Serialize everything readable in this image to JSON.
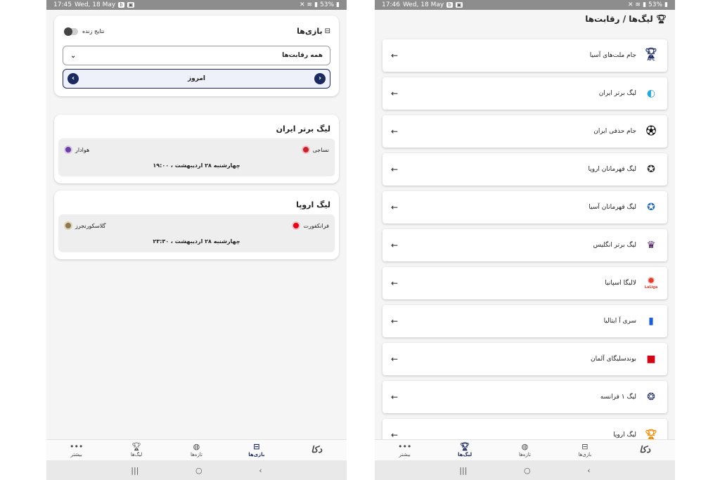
{
  "left": {
    "status": {
      "time": "17:45",
      "date": "Wed, 18 May",
      "battery": "53%"
    },
    "games_card": {
      "title": "بازی‌ها",
      "live_results_label": "نتایج زنده",
      "competition_select": "همه رقابت‌ها",
      "date_label": "امروز"
    },
    "leagues": [
      {
        "name": "لیگ برتر ایران",
        "home_team": "نساجی",
        "away_team": "هوادار",
        "time": "چهارشنبه ۲۸ اردیبهشت ، ۱۹:۰۰"
      },
      {
        "name": "لیگ اروپا",
        "home_team": "فرانکفورت",
        "away_team": "گلاسکورنجرز",
        "time": "چهارشنبه ۲۸ اردیبهشت ، ۲۳:۳۰"
      }
    ],
    "nav": {
      "more": "بیشتر",
      "leagues": "لیگ‌ها",
      "news": "تازه‌ها",
      "games": "بازی‌ها",
      "brand": "دکا"
    }
  },
  "right": {
    "status": {
      "time": "17:46",
      "date": "Wed, 18 May",
      "battery": "53%"
    },
    "header": "لیگ‌ها / رقابت‌ها",
    "items": [
      {
        "label": "جام ملت‌های آسیا",
        "icon": "asian-cup-logo",
        "logo_text": "AFC"
      },
      {
        "label": "لیگ برتر ایران",
        "icon": "persian-gulf-league-logo",
        "logo_text": ""
      },
      {
        "label": "جام حذفی ایران",
        "icon": "hazfi-cup-logo",
        "logo_text": ""
      },
      {
        "label": "لیگ قهرمانان اروپا",
        "icon": "champions-league-logo",
        "logo_text": ""
      },
      {
        "label": "لیگ قهرمانان آسیا",
        "icon": "afc-champions-league-logo",
        "logo_text": ""
      },
      {
        "label": "لیگ برتر انگلیس",
        "icon": "premier-league-logo",
        "logo_text": ""
      },
      {
        "label": "لالیگا اسپانیا",
        "icon": "laliga-logo",
        "logo_text": "LaLiga"
      },
      {
        "label": "سری آ ایتالیا",
        "icon": "serie-a-logo",
        "logo_text": ""
      },
      {
        "label": "بوندسلیگای آلمان",
        "icon": "bundesliga-logo",
        "logo_text": ""
      },
      {
        "label": "لیگ ۱ فرانسه",
        "icon": "ligue1-logo",
        "logo_text": ""
      },
      {
        "label": "لیگ اروپا",
        "icon": "europa-league-logo",
        "logo_text": ""
      }
    ],
    "nav": {
      "more": "بیشتر",
      "leagues": "لیگ‌ها",
      "news": "تازه‌ها",
      "games": "بازی‌ها",
      "brand": "دکا"
    }
  },
  "colors": {
    "accent": "#1b2a5e",
    "status_bar": "#8d8d8d",
    "background": "#f5f5f5"
  }
}
